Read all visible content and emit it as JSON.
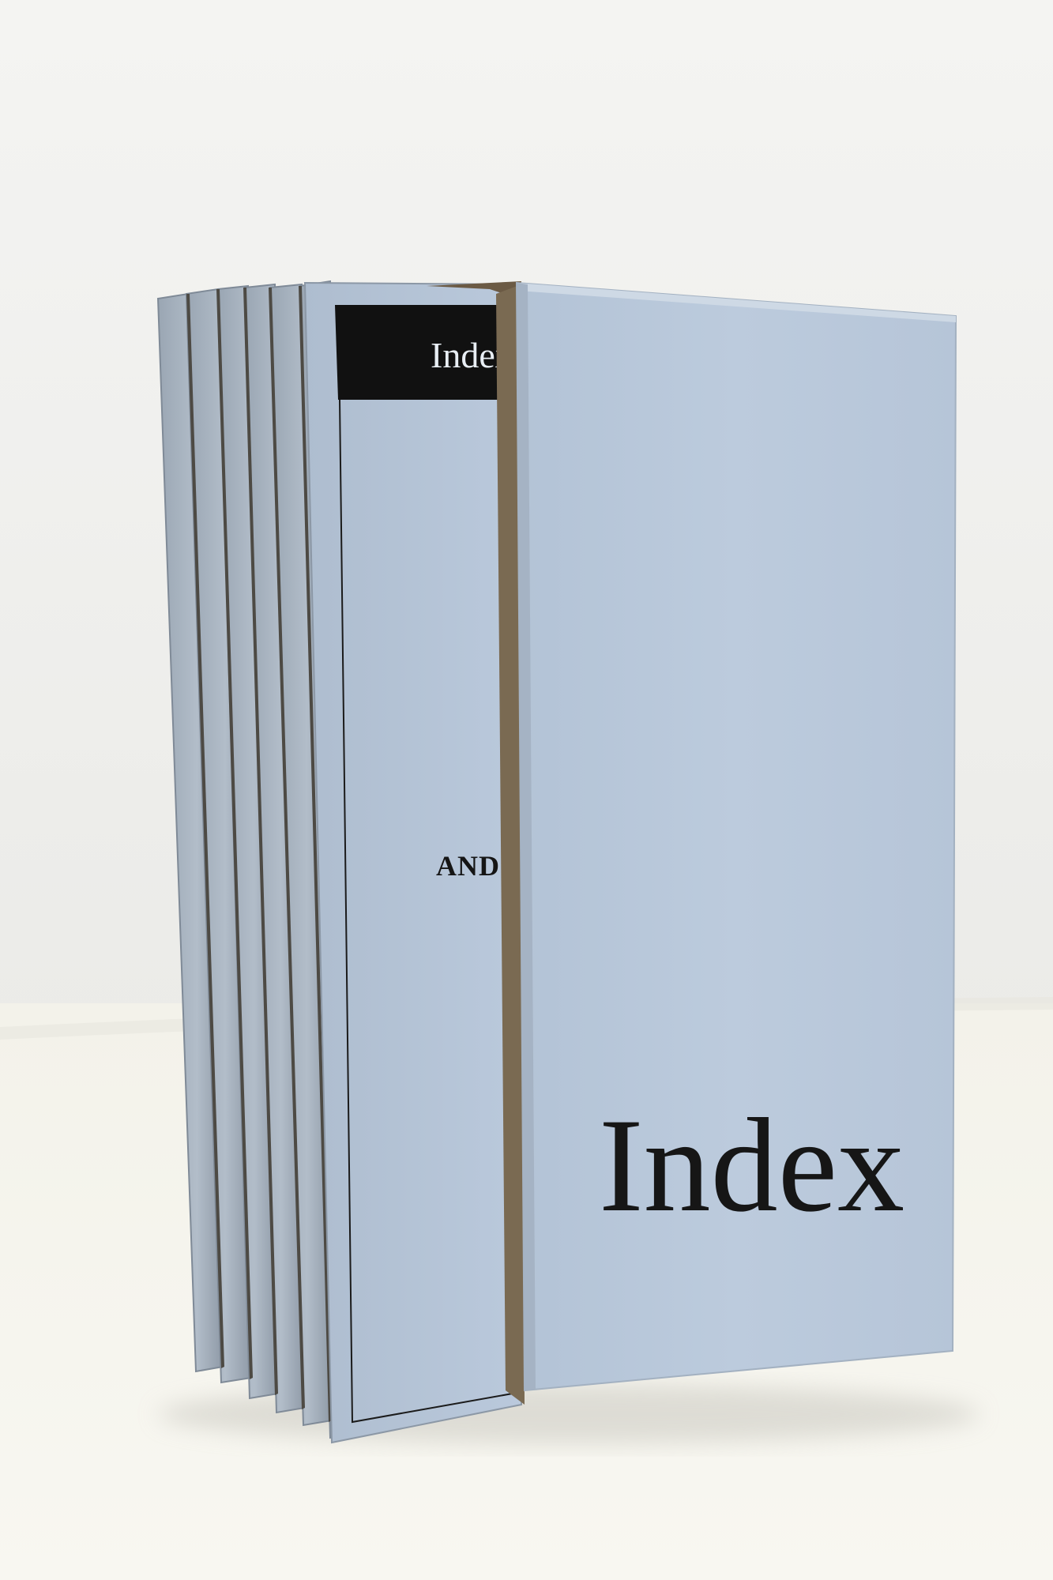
{
  "photo": {
    "subject": "slipcase with booklets",
    "colors": {
      "wall": "#f0f0ee",
      "table": "#f6f5ee",
      "card": "#b9c9dc",
      "card_edge": "#a9b6c4",
      "card_dark": "#8e9aa8",
      "cardboard": "#6b5a44",
      "banner": "#111111",
      "ink": "#151515"
    }
  },
  "booklet": {
    "banner_text": "Index o",
    "label_text": "AND L"
  },
  "slipcase": {
    "title": "Index"
  }
}
